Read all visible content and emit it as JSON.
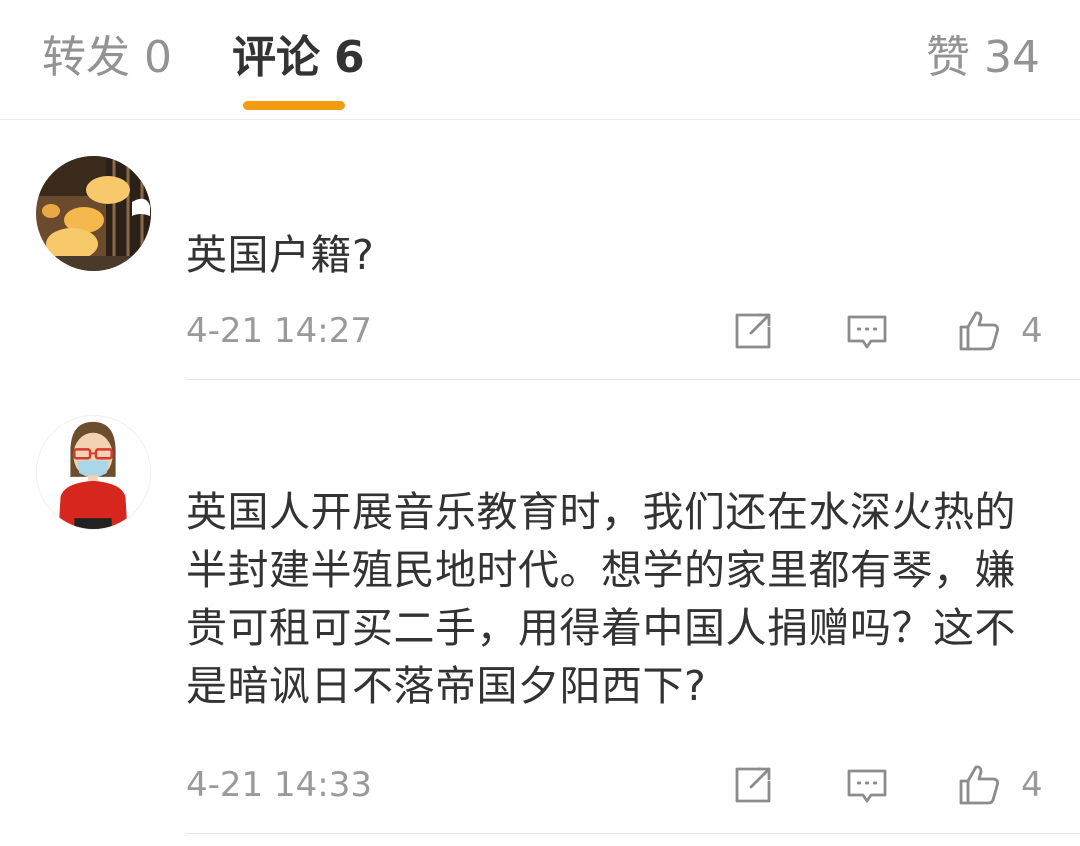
{
  "tabs": {
    "repost_label": "转发",
    "repost_count": "0",
    "comments_label": "评论",
    "comments_count": "6",
    "likes_label": "赞",
    "likes_count": "34"
  },
  "colors": {
    "accent": "#f39c12",
    "text_primary": "#333333",
    "text_secondary": "#9a9a9a",
    "divider": "#e6e6e6"
  },
  "comments": [
    {
      "avatar": "lantern-photo-avatar",
      "username": "",
      "text": "英国户籍?",
      "timestamp": "4-21 14:27",
      "like_count": "4"
    },
    {
      "avatar": "masked-woman-cartoon-avatar",
      "username": "",
      "text": "英国人开展音乐教育时，我们还在水深火热的半封建半殖民地时代。想学的家里都有琴，嫌贵可租可买二手，用得着中国人捐赠吗？这不是暗讽日不落帝国夕阳西下?",
      "timestamp": "4-21 14:33",
      "like_count": "4"
    }
  ],
  "icons": {
    "repost": "repost-icon",
    "reply": "comment-icon",
    "like": "thumbs-up-icon"
  }
}
